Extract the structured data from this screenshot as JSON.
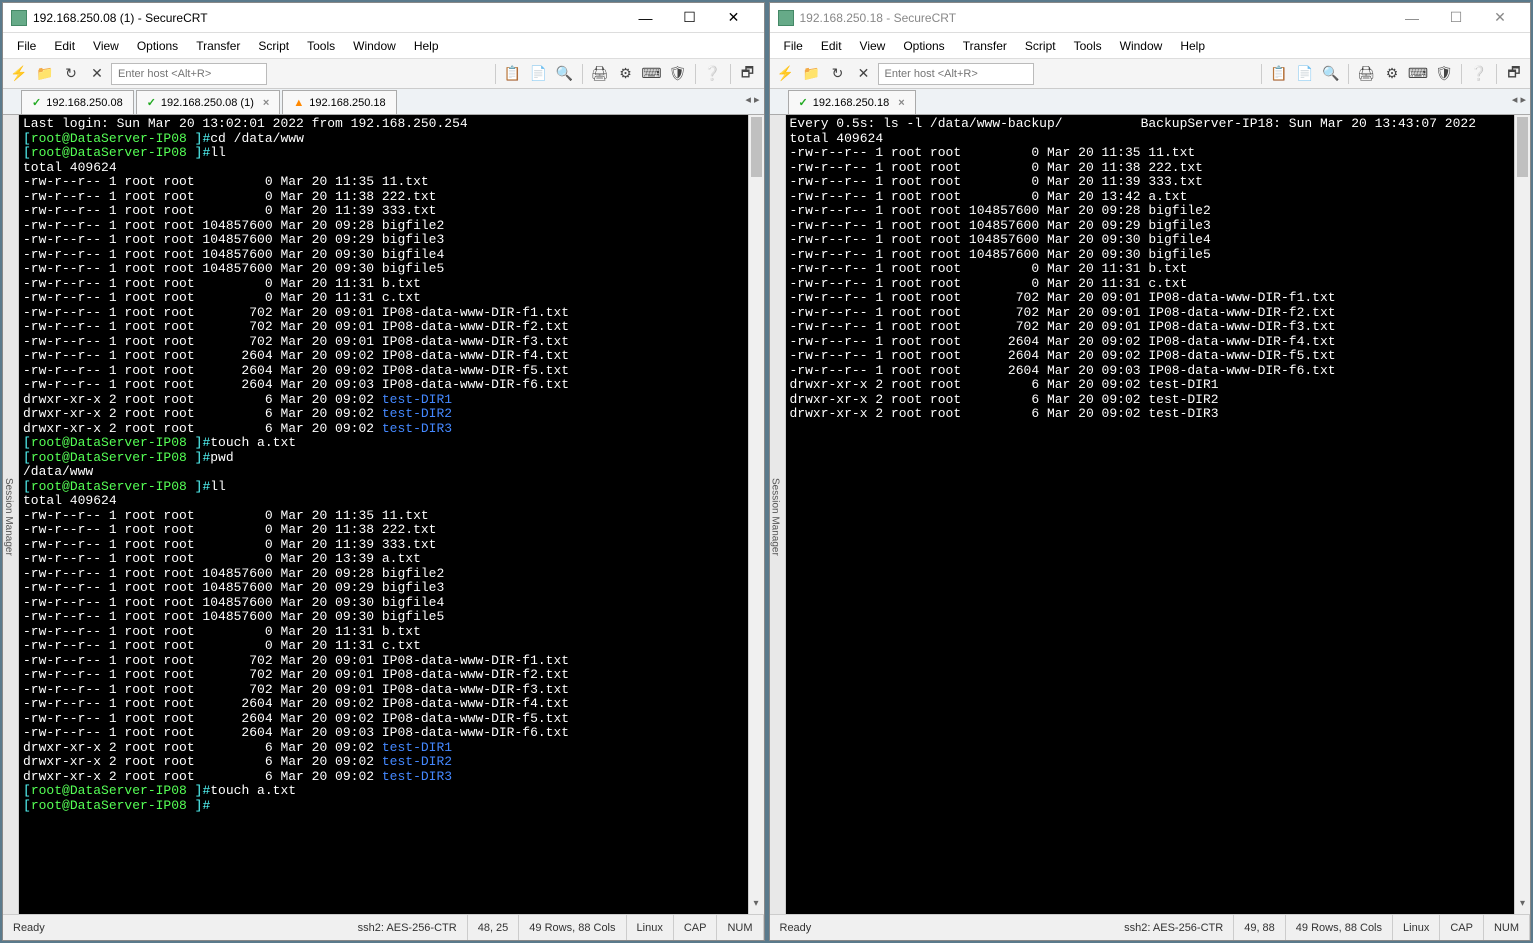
{
  "left": {
    "title": "192.168.250.08 (1) - SecureCRT",
    "menus": [
      "File",
      "Edit",
      "View",
      "Options",
      "Transfer",
      "Script",
      "Tools",
      "Window",
      "Help"
    ],
    "host_placeholder": "Enter host <Alt+R>",
    "tabs": [
      {
        "kind": "chk",
        "label": "192.168.250.08",
        "close": false
      },
      {
        "kind": "chk",
        "label": "192.168.250.08 (1)",
        "close": true
      },
      {
        "kind": "tri",
        "label": "192.168.250.18",
        "close": false
      }
    ],
    "session_mgr": "Session Manager",
    "lines": [
      {
        "segs": [
          {
            "c": "white",
            "t": "Last login: Sun Mar 20 13:02:01 2022 from 192.168.250.254"
          }
        ]
      },
      {
        "segs": [
          {
            "c": "cyan",
            "t": "["
          },
          {
            "c": "green",
            "t": "root@DataServer-IP08 "
          },
          {
            "c": "cyan",
            "t": "]#"
          },
          {
            "c": "white",
            "t": "cd /data/www"
          }
        ]
      },
      {
        "segs": [
          {
            "c": "cyan",
            "t": "["
          },
          {
            "c": "green",
            "t": "root@DataServer-IP08 "
          },
          {
            "c": "cyan",
            "t": "]#"
          },
          {
            "c": "white",
            "t": "ll"
          }
        ]
      },
      {
        "segs": [
          {
            "c": "white",
            "t": "total 409624"
          }
        ]
      },
      {
        "segs": [
          {
            "c": "white",
            "t": "-rw-r--r-- 1 root root         0 Mar 20 11:35 11.txt"
          }
        ]
      },
      {
        "segs": [
          {
            "c": "white",
            "t": "-rw-r--r-- 1 root root         0 Mar 20 11:38 222.txt"
          }
        ]
      },
      {
        "segs": [
          {
            "c": "white",
            "t": "-rw-r--r-- 1 root root         0 Mar 20 11:39 333.txt"
          }
        ]
      },
      {
        "segs": [
          {
            "c": "white",
            "t": "-rw-r--r-- 1 root root 104857600 Mar 20 09:28 bigfile2"
          }
        ]
      },
      {
        "segs": [
          {
            "c": "white",
            "t": "-rw-r--r-- 1 root root 104857600 Mar 20 09:29 bigfile3"
          }
        ]
      },
      {
        "segs": [
          {
            "c": "white",
            "t": "-rw-r--r-- 1 root root 104857600 Mar 20 09:30 bigfile4"
          }
        ]
      },
      {
        "segs": [
          {
            "c": "white",
            "t": "-rw-r--r-- 1 root root 104857600 Mar 20 09:30 bigfile5"
          }
        ]
      },
      {
        "segs": [
          {
            "c": "white",
            "t": "-rw-r--r-- 1 root root         0 Mar 20 11:31 b.txt"
          }
        ]
      },
      {
        "segs": [
          {
            "c": "white",
            "t": "-rw-r--r-- 1 root root         0 Mar 20 11:31 c.txt"
          }
        ]
      },
      {
        "segs": [
          {
            "c": "white",
            "t": "-rw-r--r-- 1 root root       702 Mar 20 09:01 IP08-data-www-DIR-f1.txt"
          }
        ]
      },
      {
        "segs": [
          {
            "c": "white",
            "t": "-rw-r--r-- 1 root root       702 Mar 20 09:01 IP08-data-www-DIR-f2.txt"
          }
        ]
      },
      {
        "segs": [
          {
            "c": "white",
            "t": "-rw-r--r-- 1 root root       702 Mar 20 09:01 IP08-data-www-DIR-f3.txt"
          }
        ]
      },
      {
        "segs": [
          {
            "c": "white",
            "t": "-rw-r--r-- 1 root root      2604 Mar 20 09:02 IP08-data-www-DIR-f4.txt"
          }
        ]
      },
      {
        "segs": [
          {
            "c": "white",
            "t": "-rw-r--r-- 1 root root      2604 Mar 20 09:02 IP08-data-www-DIR-f5.txt"
          }
        ]
      },
      {
        "segs": [
          {
            "c": "white",
            "t": "-rw-r--r-- 1 root root      2604 Mar 20 09:03 IP08-data-www-DIR-f6.txt"
          }
        ]
      },
      {
        "segs": [
          {
            "c": "white",
            "t": "drwxr-xr-x 2 root root         6 Mar 20 09:02 "
          },
          {
            "c": "blue",
            "t": "test-DIR1"
          }
        ]
      },
      {
        "segs": [
          {
            "c": "white",
            "t": "drwxr-xr-x 2 root root         6 Mar 20 09:02 "
          },
          {
            "c": "blue",
            "t": "test-DIR2"
          }
        ]
      },
      {
        "segs": [
          {
            "c": "white",
            "t": "drwxr-xr-x 2 root root         6 Mar 20 09:02 "
          },
          {
            "c": "blue",
            "t": "test-DIR3"
          }
        ]
      },
      {
        "segs": [
          {
            "c": "cyan",
            "t": "["
          },
          {
            "c": "green",
            "t": "root@DataServer-IP08 "
          },
          {
            "c": "cyan",
            "t": "]#"
          },
          {
            "c": "white",
            "t": "touch a.txt"
          }
        ]
      },
      {
        "segs": [
          {
            "c": "cyan",
            "t": "["
          },
          {
            "c": "green",
            "t": "root@DataServer-IP08 "
          },
          {
            "c": "cyan",
            "t": "]#"
          },
          {
            "c": "white",
            "t": "pwd"
          }
        ]
      },
      {
        "segs": [
          {
            "c": "white",
            "t": "/data/www"
          }
        ]
      },
      {
        "segs": [
          {
            "c": "cyan",
            "t": "["
          },
          {
            "c": "green",
            "t": "root@DataServer-IP08 "
          },
          {
            "c": "cyan",
            "t": "]#"
          },
          {
            "c": "white",
            "t": "ll"
          }
        ]
      },
      {
        "segs": [
          {
            "c": "white",
            "t": "total 409624"
          }
        ]
      },
      {
        "segs": [
          {
            "c": "white",
            "t": "-rw-r--r-- 1 root root         0 Mar 20 11:35 11.txt"
          }
        ]
      },
      {
        "segs": [
          {
            "c": "white",
            "t": "-rw-r--r-- 1 root root         0 Mar 20 11:38 222.txt"
          }
        ]
      },
      {
        "segs": [
          {
            "c": "white",
            "t": "-rw-r--r-- 1 root root         0 Mar 20 11:39 333.txt"
          }
        ]
      },
      {
        "segs": [
          {
            "c": "white",
            "t": "-rw-r--r-- 1 root root         0 Mar 20 13:39 a.txt"
          }
        ]
      },
      {
        "segs": [
          {
            "c": "white",
            "t": "-rw-r--r-- 1 root root 104857600 Mar 20 09:28 bigfile2"
          }
        ]
      },
      {
        "segs": [
          {
            "c": "white",
            "t": "-rw-r--r-- 1 root root 104857600 Mar 20 09:29 bigfile3"
          }
        ]
      },
      {
        "segs": [
          {
            "c": "white",
            "t": "-rw-r--r-- 1 root root 104857600 Mar 20 09:30 bigfile4"
          }
        ]
      },
      {
        "segs": [
          {
            "c": "white",
            "t": "-rw-r--r-- 1 root root 104857600 Mar 20 09:30 bigfile5"
          }
        ]
      },
      {
        "segs": [
          {
            "c": "white",
            "t": "-rw-r--r-- 1 root root         0 Mar 20 11:31 b.txt"
          }
        ]
      },
      {
        "segs": [
          {
            "c": "white",
            "t": "-rw-r--r-- 1 root root         0 Mar 20 11:31 c.txt"
          }
        ]
      },
      {
        "segs": [
          {
            "c": "white",
            "t": "-rw-r--r-- 1 root root       702 Mar 20 09:01 IP08-data-www-DIR-f1.txt"
          }
        ]
      },
      {
        "segs": [
          {
            "c": "white",
            "t": "-rw-r--r-- 1 root root       702 Mar 20 09:01 IP08-data-www-DIR-f2.txt"
          }
        ]
      },
      {
        "segs": [
          {
            "c": "white",
            "t": "-rw-r--r-- 1 root root       702 Mar 20 09:01 IP08-data-www-DIR-f3.txt"
          }
        ]
      },
      {
        "segs": [
          {
            "c": "white",
            "t": "-rw-r--r-- 1 root root      2604 Mar 20 09:02 IP08-data-www-DIR-f4.txt"
          }
        ]
      },
      {
        "segs": [
          {
            "c": "white",
            "t": "-rw-r--r-- 1 root root      2604 Mar 20 09:02 IP08-data-www-DIR-f5.txt"
          }
        ]
      },
      {
        "segs": [
          {
            "c": "white",
            "t": "-rw-r--r-- 1 root root      2604 Mar 20 09:03 IP08-data-www-DIR-f6.txt"
          }
        ]
      },
      {
        "segs": [
          {
            "c": "white",
            "t": "drwxr-xr-x 2 root root         6 Mar 20 09:02 "
          },
          {
            "c": "blue",
            "t": "test-DIR1"
          }
        ]
      },
      {
        "segs": [
          {
            "c": "white",
            "t": "drwxr-xr-x 2 root root         6 Mar 20 09:02 "
          },
          {
            "c": "blue",
            "t": "test-DIR2"
          }
        ]
      },
      {
        "segs": [
          {
            "c": "white",
            "t": "drwxr-xr-x 2 root root         6 Mar 20 09:02 "
          },
          {
            "c": "blue",
            "t": "test-DIR3"
          }
        ]
      },
      {
        "segs": [
          {
            "c": "cyan",
            "t": "["
          },
          {
            "c": "green",
            "t": "root@DataServer-IP08 "
          },
          {
            "c": "cyan",
            "t": "]#"
          },
          {
            "c": "white",
            "t": "touch a.txt"
          }
        ]
      },
      {
        "segs": [
          {
            "c": "cyan",
            "t": "["
          },
          {
            "c": "green",
            "t": "root@DataServer-IP08 "
          },
          {
            "c": "cyan",
            "t": "]#"
          }
        ]
      }
    ],
    "status": {
      "ready": "Ready",
      "conn": "ssh2: AES-256-CTR",
      "pos": "48,  25",
      "rc": "49 Rows, 88 Cols",
      "os": "Linux",
      "cap": "CAP",
      "num": "NUM"
    }
  },
  "right": {
    "title": "192.168.250.18 - SecureCRT",
    "menus": [
      "File",
      "Edit",
      "View",
      "Options",
      "Transfer",
      "Script",
      "Tools",
      "Window",
      "Help"
    ],
    "host_placeholder": "Enter host <Alt+R>",
    "tabs": [
      {
        "kind": "chk",
        "label": "192.168.250.18",
        "close": true
      }
    ],
    "session_mgr": "Session Manager",
    "header_left": "Every 0.5s: ls -l /data/www-backup/",
    "header_right": "BackupServer-IP18: Sun Mar 20 13:43:07 2022",
    "lines": [
      {
        "segs": [
          {
            "c": "white",
            "t": "total 409624"
          }
        ]
      },
      {
        "segs": [
          {
            "c": "white",
            "t": "-rw-r--r-- 1 root root         0 Mar 20 11:35 11.txt"
          }
        ]
      },
      {
        "segs": [
          {
            "c": "white",
            "t": "-rw-r--r-- 1 root root         0 Mar 20 11:38 222.txt"
          }
        ]
      },
      {
        "segs": [
          {
            "c": "white",
            "t": "-rw-r--r-- 1 root root         0 Mar 20 11:39 333.txt"
          }
        ]
      },
      {
        "segs": [
          {
            "c": "white",
            "t": "-rw-r--r-- 1 root root         0 Mar 20 13:42 a.txt"
          }
        ]
      },
      {
        "segs": [
          {
            "c": "white",
            "t": "-rw-r--r-- 1 root root 104857600 Mar 20 09:28 bigfile2"
          }
        ]
      },
      {
        "segs": [
          {
            "c": "white",
            "t": "-rw-r--r-- 1 root root 104857600 Mar 20 09:29 bigfile3"
          }
        ]
      },
      {
        "segs": [
          {
            "c": "white",
            "t": "-rw-r--r-- 1 root root 104857600 Mar 20 09:30 bigfile4"
          }
        ]
      },
      {
        "segs": [
          {
            "c": "white",
            "t": "-rw-r--r-- 1 root root 104857600 Mar 20 09:30 bigfile5"
          }
        ]
      },
      {
        "segs": [
          {
            "c": "white",
            "t": "-rw-r--r-- 1 root root         0 Mar 20 11:31 b.txt"
          }
        ]
      },
      {
        "segs": [
          {
            "c": "white",
            "t": "-rw-r--r-- 1 root root         0 Mar 20 11:31 c.txt"
          }
        ]
      },
      {
        "segs": [
          {
            "c": "white",
            "t": "-rw-r--r-- 1 root root       702 Mar 20 09:01 IP08-data-www-DIR-f1.txt"
          }
        ]
      },
      {
        "segs": [
          {
            "c": "white",
            "t": "-rw-r--r-- 1 root root       702 Mar 20 09:01 IP08-data-www-DIR-f2.txt"
          }
        ]
      },
      {
        "segs": [
          {
            "c": "white",
            "t": "-rw-r--r-- 1 root root       702 Mar 20 09:01 IP08-data-www-DIR-f3.txt"
          }
        ]
      },
      {
        "segs": [
          {
            "c": "white",
            "t": "-rw-r--r-- 1 root root      2604 Mar 20 09:02 IP08-data-www-DIR-f4.txt"
          }
        ]
      },
      {
        "segs": [
          {
            "c": "white",
            "t": "-rw-r--r-- 1 root root      2604 Mar 20 09:02 IP08-data-www-DIR-f5.txt"
          }
        ]
      },
      {
        "segs": [
          {
            "c": "white",
            "t": "-rw-r--r-- 1 root root      2604 Mar 20 09:03 IP08-data-www-DIR-f6.txt"
          }
        ]
      },
      {
        "segs": [
          {
            "c": "white",
            "t": "drwxr-xr-x 2 root root         6 Mar 20 09:02 test-DIR1"
          }
        ]
      },
      {
        "segs": [
          {
            "c": "white",
            "t": "drwxr-xr-x 2 root root         6 Mar 20 09:02 test-DIR2"
          }
        ]
      },
      {
        "segs": [
          {
            "c": "white",
            "t": "drwxr-xr-x 2 root root         6 Mar 20 09:02 test-DIR3"
          }
        ]
      }
    ],
    "status": {
      "ready": "Ready",
      "conn": "ssh2: AES-256-CTR",
      "pos": "49,  88",
      "rc": "49 Rows, 88 Cols",
      "os": "Linux",
      "cap": "CAP",
      "num": "NUM"
    }
  },
  "toolbar_icons": [
    "⚡",
    "📁",
    "↻",
    "✕",
    "",
    "📋",
    "📄",
    "🔍",
    "",
    "🖨",
    "⚙",
    "⌨",
    "🛡",
    "",
    "❔",
    "",
    "🗗"
  ]
}
